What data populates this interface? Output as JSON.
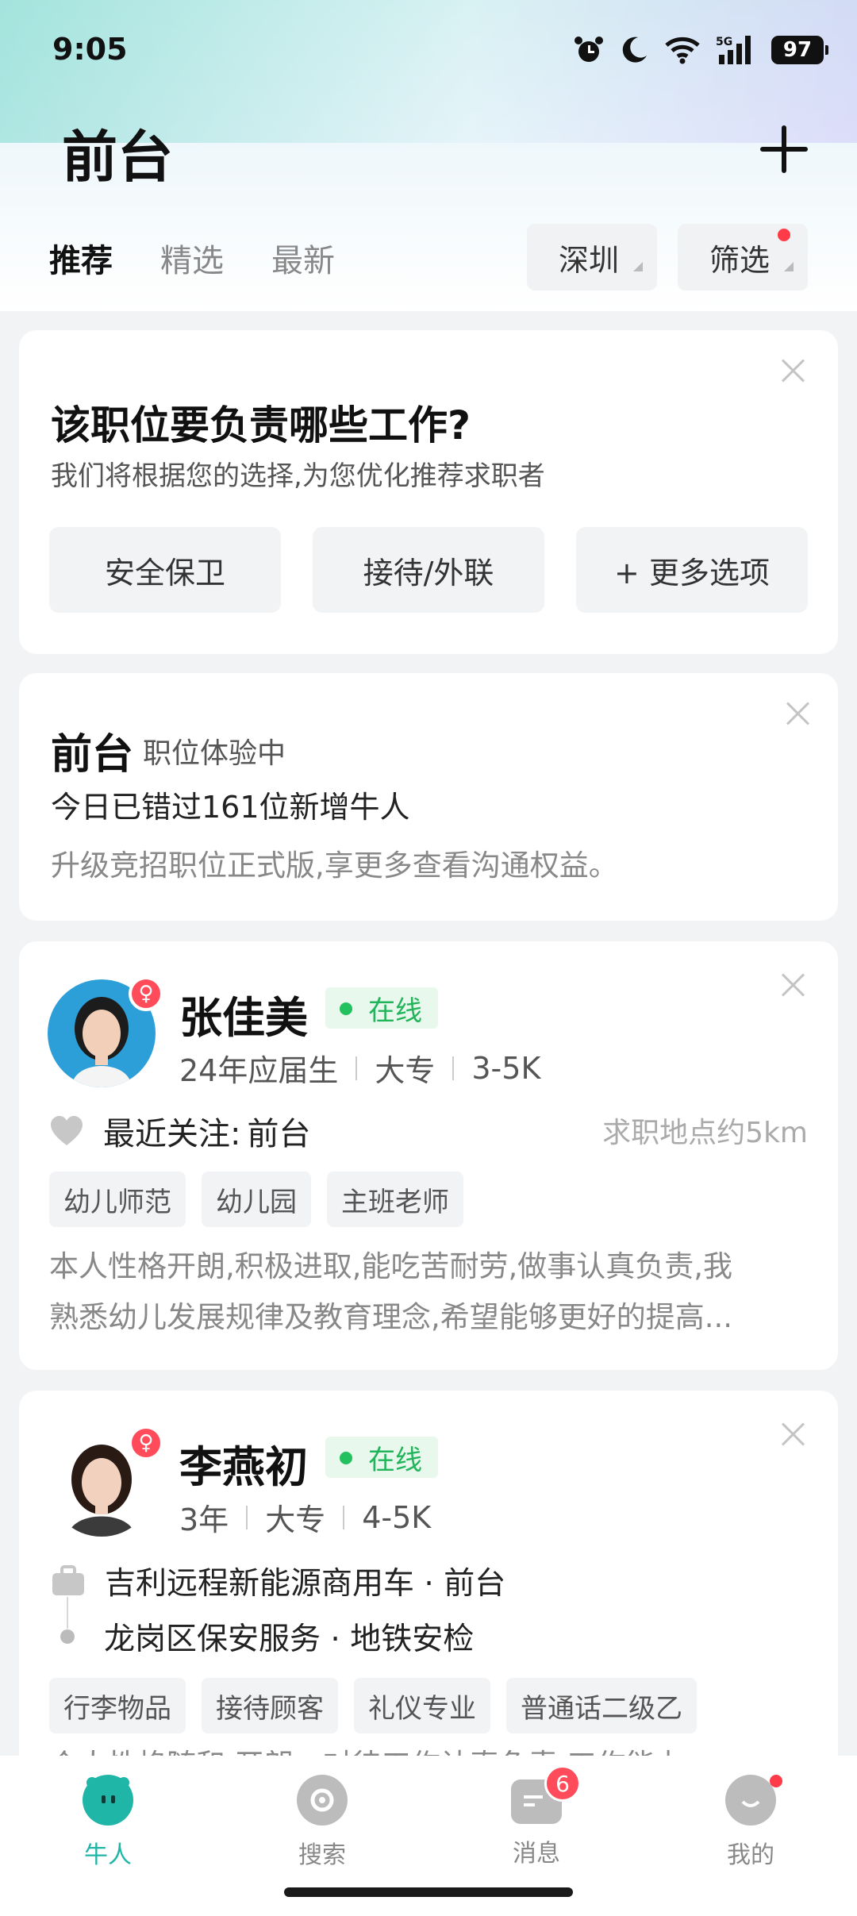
{
  "status": {
    "time": "9:05",
    "battery": "97",
    "network": "5G",
    "icons": [
      "alarm-icon",
      "moon-icon",
      "wifi-icon",
      "signal-icon",
      "battery-icon"
    ]
  },
  "header": {
    "title": "前台",
    "add_icon": "plus-icon"
  },
  "tabs": [
    {
      "label": "推荐",
      "active": true
    },
    {
      "label": "精选",
      "active": false
    },
    {
      "label": "最新",
      "active": false
    }
  ],
  "filters": {
    "city": "深圳",
    "filter": "筛选"
  },
  "question_card": {
    "title": "该职位要负责哪些工作?",
    "subtitle": "我们将根据您的选择,为您优化推荐求职者",
    "options": [
      "安全保卫",
      "接待/外联",
      "+ 更多选项"
    ]
  },
  "trial_card": {
    "title": "前台",
    "tag": "职位体验中",
    "line": "今日已错过161位新增牛人",
    "desc": "升级竞招职位正式版,享更多查看沟通权益。"
  },
  "candidates": [
    {
      "name": "张佳美",
      "online": "在线",
      "meta": [
        "24年应届生",
        "大专",
        "3-5K"
      ],
      "follow_label": "最近关注:",
      "follow_value": "前台",
      "distance": "求职地点约5km",
      "tags": [
        "幼儿师范",
        "幼儿园",
        "主班老师"
      ],
      "desc_line1": "本人性格开朗,积极进取,能吃苦耐劳,做事认真负责,我",
      "desc_line2": "熟悉幼儿发展规律及教育理念,希望能够更好的提高..."
    },
    {
      "name": "李燕初",
      "online": "在线",
      "meta": [
        "3年",
        "大专",
        "4-5K"
      ],
      "experience": [
        "吉利远程新能源商用车 · 前台",
        "龙岗区保安服务 · 地铁安检"
      ],
      "tags": [
        "行李物品",
        "接待顾客",
        "礼仪专业",
        "普通话二级乙"
      ],
      "desc_line1": "个人性格随和,开朗。对待工作认真负责,工作能力..."
    }
  ],
  "bottom_nav": {
    "items": [
      {
        "label": "牛人",
        "icon": "niuren-icon",
        "active": true
      },
      {
        "label": "搜索",
        "icon": "search-icon",
        "active": false
      },
      {
        "label": "消息",
        "icon": "message-icon",
        "active": false,
        "badge": "6"
      },
      {
        "label": "我的",
        "icon": "profile-icon",
        "active": false
      }
    ]
  },
  "colors": {
    "accent": "#1fb6a8",
    "online_green": "#22b45a",
    "badge_red": "#ff4b5a"
  }
}
